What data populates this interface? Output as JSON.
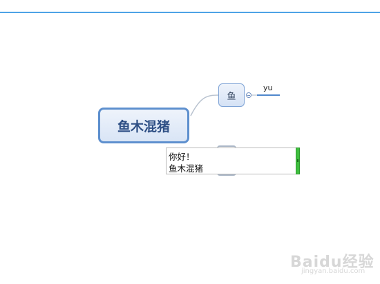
{
  "mindmap": {
    "central_topic": "鱼木混猪",
    "subtopic": "鱼",
    "child_topic": "yu"
  },
  "note": {
    "lines": [
      "你好！",
      "鱼木混猪"
    ]
  },
  "watermark": {
    "brand": "Baidu经验",
    "url": "jingyan.baidu.com"
  },
  "colors": {
    "accent": "#4ea3e6",
    "topic_border": "#5d8fce",
    "resize_handle": "#3fbf3f"
  }
}
